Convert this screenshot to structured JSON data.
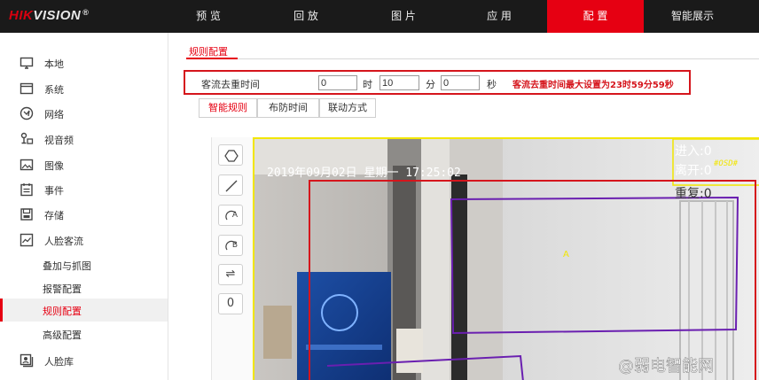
{
  "brand": {
    "logo_prefix": "HIK",
    "logo_rest": "VISION",
    "logo_mark": "®"
  },
  "nav": {
    "items": [
      {
        "label": "预 览"
      },
      {
        "label": "回 放"
      },
      {
        "label": "图 片"
      },
      {
        "label": "应 用"
      },
      {
        "label": "配 置"
      },
      {
        "label": "智能展示"
      }
    ],
    "active_index": 4
  },
  "sidebar": {
    "items": [
      {
        "label": "本地",
        "icon": "monitor-icon"
      },
      {
        "label": "系统",
        "icon": "system-window-icon"
      },
      {
        "label": "网络",
        "icon": "network-globe-icon"
      },
      {
        "label": "视音频",
        "icon": "audio-video-icon"
      },
      {
        "label": "图像",
        "icon": "image-icon"
      },
      {
        "label": "事件",
        "icon": "event-calendar-icon"
      },
      {
        "label": "存储",
        "icon": "storage-disk-icon"
      },
      {
        "label": "人脸客流",
        "icon": "face-flow-chart-icon"
      }
    ],
    "subitems": [
      {
        "label": "叠加与抓图"
      },
      {
        "label": "报警配置"
      },
      {
        "label": "规则配置"
      },
      {
        "label": "高级配置"
      }
    ],
    "active_subitem": "规则配置",
    "bottom_item": {
      "label": "人脸库",
      "icon": "face-library-icon"
    }
  },
  "page": {
    "title": "规则配置",
    "dedup": {
      "label": "客流去重时间",
      "hours_value": "0",
      "hours_unit": "时",
      "minutes_value": "10",
      "minutes_unit": "分",
      "seconds_value": "0",
      "seconds_unit": "秒",
      "hint": "客流去重时间最大设置为23时59分59秒"
    },
    "tabs": [
      {
        "label": "智能规则"
      },
      {
        "label": "布防时间"
      },
      {
        "label": "联动方式"
      }
    ],
    "active_tab": "智能规则"
  },
  "tools": {
    "items": [
      {
        "name": "draw-polygon-icon"
      },
      {
        "name": "draw-line-icon"
      },
      {
        "name": "region-a-icon",
        "letter": "A"
      },
      {
        "name": "region-b-icon",
        "letter": "B"
      },
      {
        "name": "swap-direction-icon",
        "glyph": "⇌"
      },
      {
        "name": "reset-count-icon",
        "glyph": "0"
      }
    ]
  },
  "video": {
    "timestamp": "2019年09月02日  星期一  17:25:02",
    "osd_tag": "#OSD#",
    "counters": [
      {
        "label": "进入:",
        "value": "0"
      },
      {
        "label": "离开:",
        "value": "0"
      },
      {
        "label": "重复:",
        "value": "0"
      }
    ],
    "region_label": "A",
    "watermark": "@弱电智能网",
    "colors": {
      "frame": "#f2e600",
      "detect_region": "#d5151c",
      "rule_region": "#6a1fb0",
      "osd_text": "#ffffff",
      "region_label": "#f2e600"
    }
  },
  "colors": {
    "accent": "#e60012",
    "topbar": "#1a1a1a",
    "hint": "#d5151c"
  }
}
